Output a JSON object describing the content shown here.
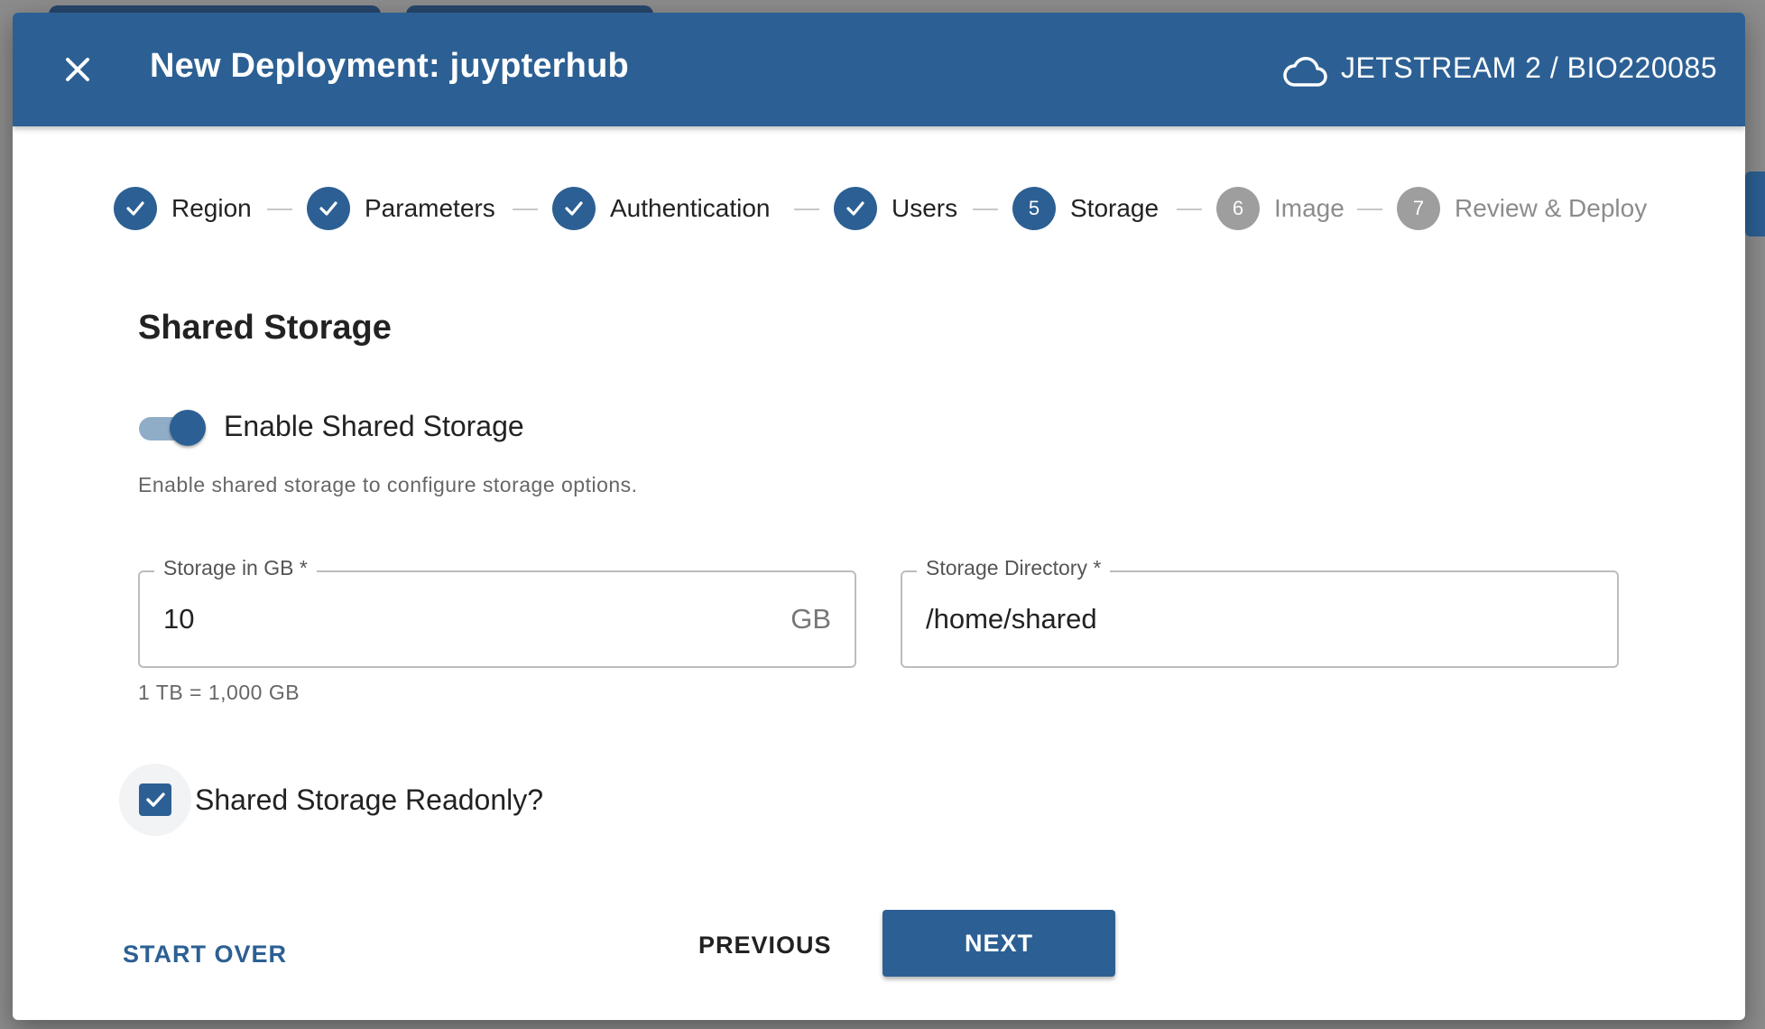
{
  "dialog": {
    "title": "New Deployment: juypterhub",
    "context": "JETSTREAM 2 / BIO220085",
    "close_icon": "close-icon",
    "cloud_icon": "cloud-icon"
  },
  "stepper": {
    "steps": [
      {
        "label": "Region",
        "status": "done",
        "indicator": "check-icon"
      },
      {
        "label": "Parameters",
        "status": "done",
        "indicator": "check-icon"
      },
      {
        "label": "Authentication",
        "status": "done",
        "indicator": "check-icon"
      },
      {
        "label": "Users",
        "status": "done",
        "indicator": "check-icon"
      },
      {
        "label": "Storage",
        "status": "active",
        "number": "5"
      },
      {
        "label": "Image",
        "status": "pending",
        "number": "6"
      },
      {
        "label": "Review & Deploy",
        "status": "pending",
        "number": "7"
      }
    ]
  },
  "form": {
    "section_title": "Shared Storage",
    "enable_toggle": {
      "label": "Enable Shared Storage",
      "checked": true
    },
    "helper_text": "Enable shared storage to configure storage options.",
    "storage_size": {
      "legend": "Storage in GB *",
      "value": "10",
      "suffix": "GB",
      "hint": "1 TB = 1,000 GB"
    },
    "storage_directory": {
      "legend": "Storage Directory *",
      "value": "/home/shared"
    },
    "readonly_checkbox": {
      "label": "Shared Storage Readonly?",
      "checked": true
    }
  },
  "actions": {
    "start_over": "START OVER",
    "previous": "PREVIOUS",
    "next": "NEXT"
  },
  "colors": {
    "primary": "#2c6094",
    "pending": "#9e9e9e"
  }
}
